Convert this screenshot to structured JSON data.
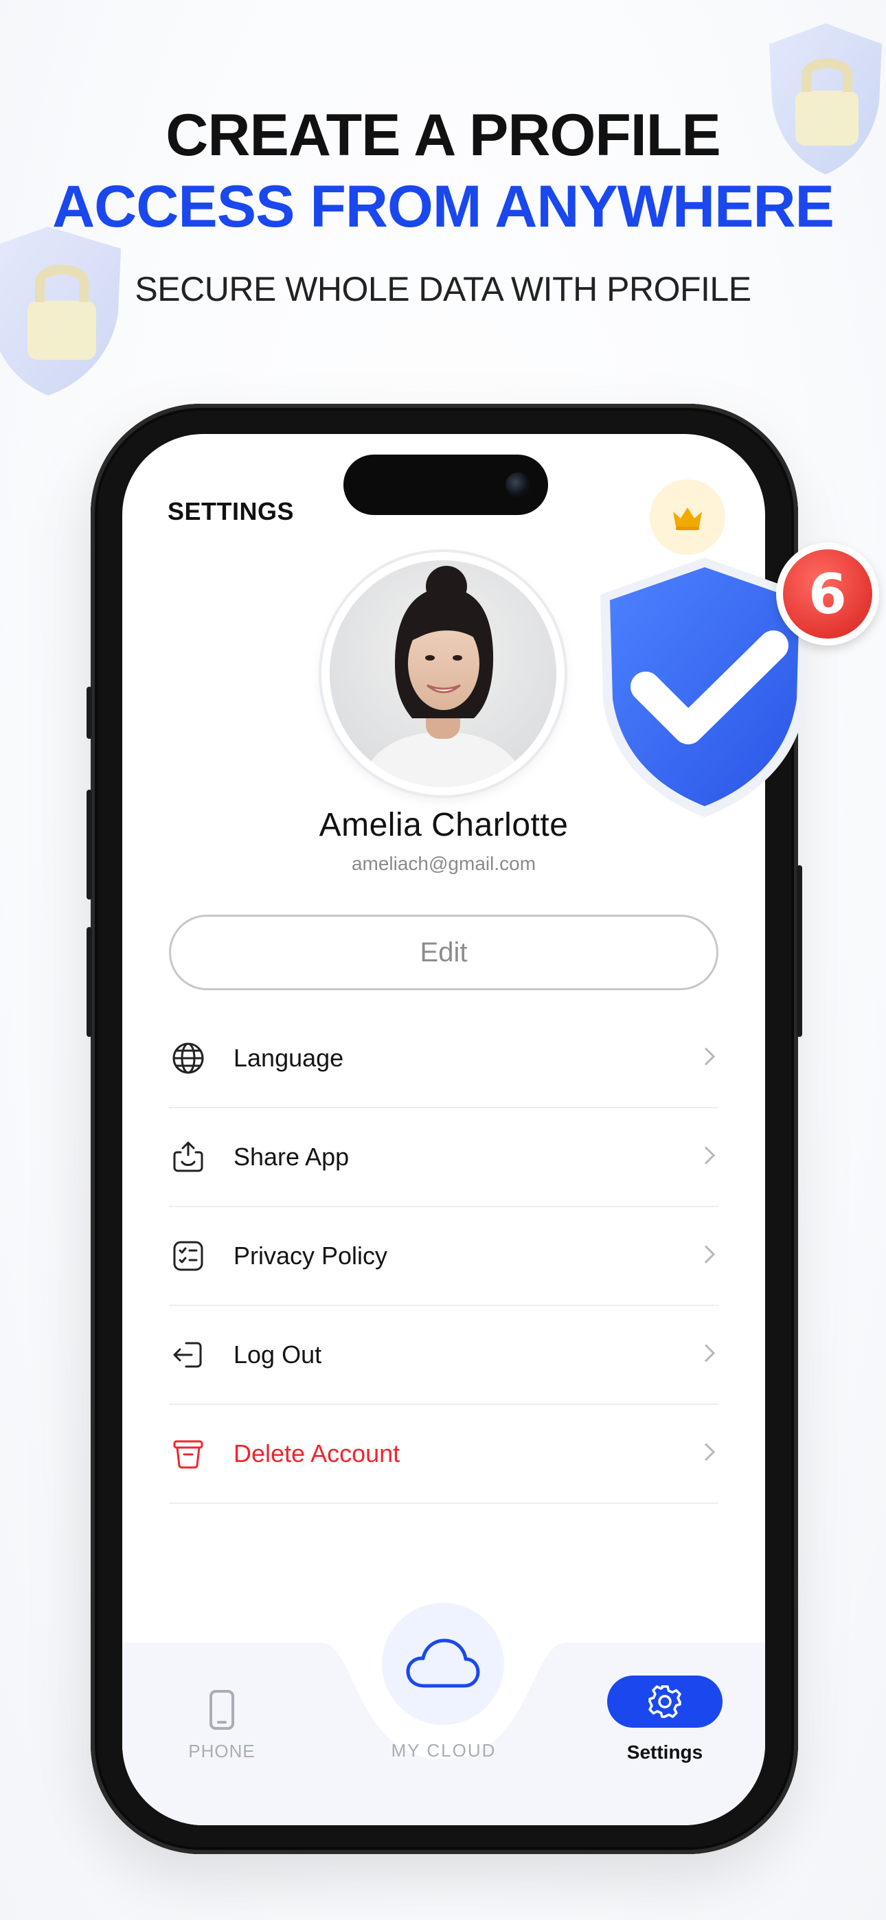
{
  "promo": {
    "line1": "CREATE A PROFILE",
    "line2": "ACCESS FROM ANYWHERE",
    "line3": "SECURE WHOLE DATA WITH PROFILE"
  },
  "app": {
    "title": "SETTINGS",
    "profile": {
      "name": "Amelia Charlotte",
      "email": "ameliach@gmail.com",
      "edit_label": "Edit"
    },
    "menu": [
      {
        "label": "Language",
        "icon": "globe-icon"
      },
      {
        "label": "Share App",
        "icon": "share-icon"
      },
      {
        "label": "Privacy Policy",
        "icon": "policy-icon"
      },
      {
        "label": "Log Out",
        "icon": "logout-icon"
      },
      {
        "label": "Delete Account",
        "icon": "trash-icon"
      }
    ],
    "nav": {
      "phone": "PHONE",
      "my_cloud": "MY CLOUD",
      "settings": "Settings"
    }
  },
  "badge": {
    "count": "6"
  },
  "colors": {
    "accent": "#1a48ee",
    "danger": "#f0252e",
    "crown": "#f2a900"
  }
}
